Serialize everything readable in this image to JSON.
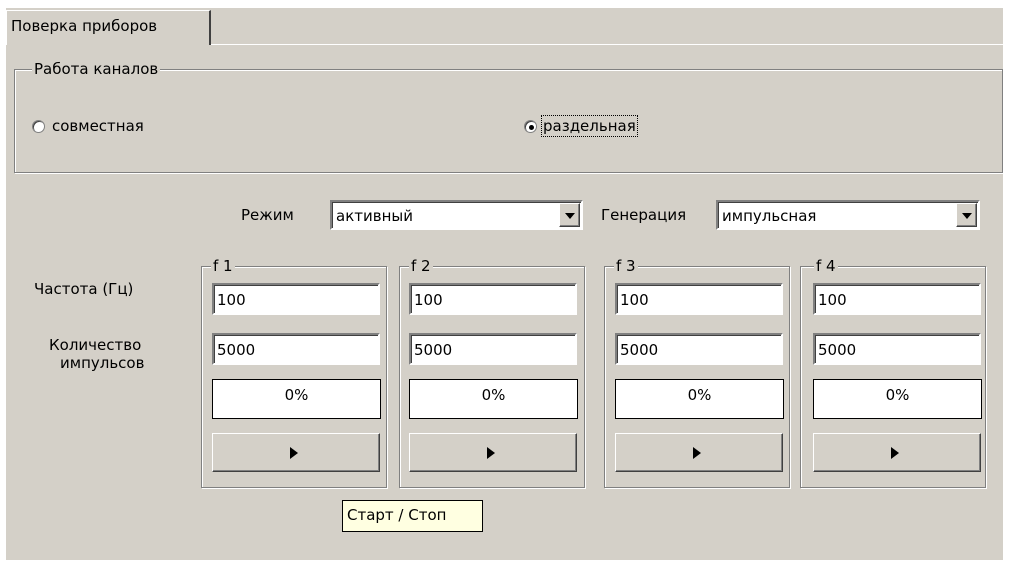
{
  "tab": {
    "label": "Поверка приборов"
  },
  "channels_group": {
    "title": "Работа каналов",
    "options": [
      {
        "label": "совместная",
        "selected": false
      },
      {
        "label": "раздельная",
        "selected": true
      }
    ]
  },
  "mode": {
    "label": "Режим",
    "value": "активный"
  },
  "generation": {
    "label": "Генерация",
    "value": "импульсная"
  },
  "row_labels": {
    "frequency": "Частота (Гц)",
    "pulses_line1": "Количество",
    "pulses_line2": "импульсов"
  },
  "channels": [
    {
      "name": "f 1",
      "frequency": "100",
      "pulses": "5000",
      "progress": "0%"
    },
    {
      "name": "f 2",
      "frequency": "100",
      "pulses": "5000",
      "progress": "0%"
    },
    {
      "name": "f 3",
      "frequency": "100",
      "pulses": "5000",
      "progress": "0%"
    },
    {
      "name": "f 4",
      "frequency": "100",
      "pulses": "5000",
      "progress": "0%"
    }
  ],
  "tooltip": "Старт / Стоп",
  "icons": {
    "combo_arrow": "chevron-down-icon",
    "start": "play-icon"
  }
}
